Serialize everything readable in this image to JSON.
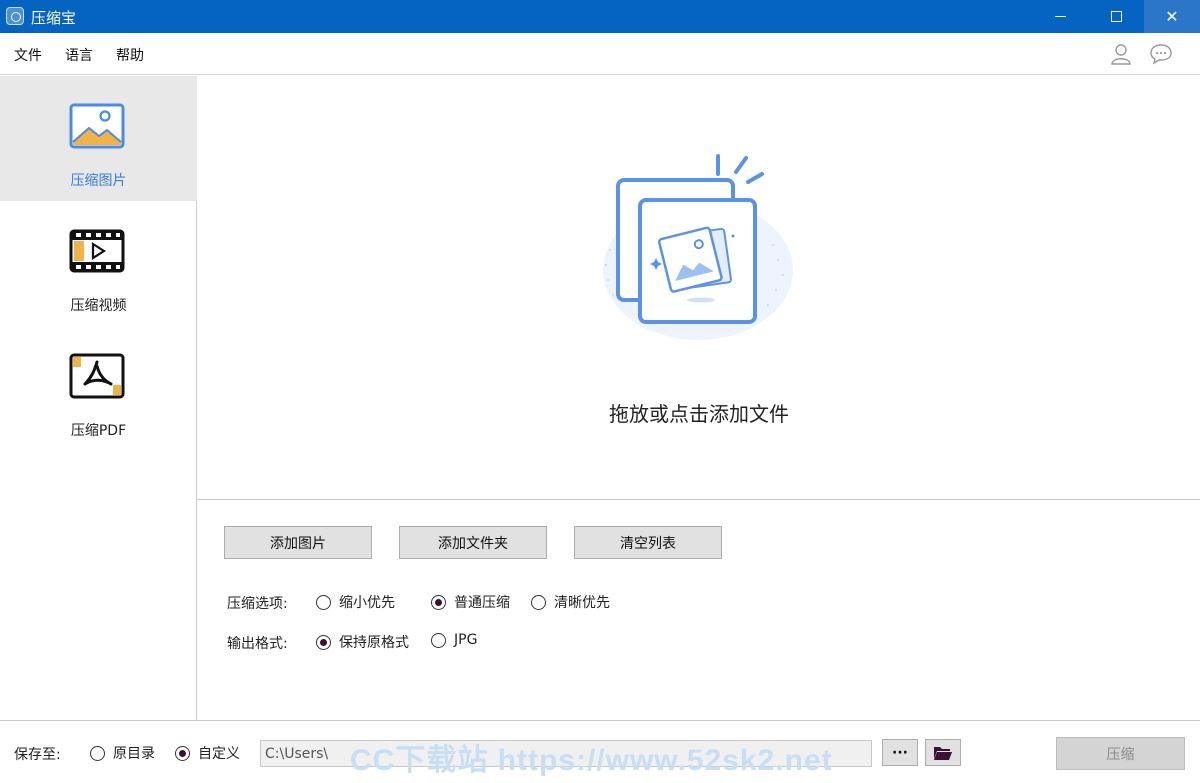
{
  "titlebar": {
    "title": "压缩宝",
    "close_glyph": "✕"
  },
  "menu": {
    "items": [
      {
        "label": "文件"
      },
      {
        "label": "语言"
      },
      {
        "label": "帮助"
      }
    ],
    "icons": [
      "user-icon",
      "chat-icon"
    ]
  },
  "sidebar": {
    "items": [
      {
        "label": "压缩图片",
        "icon": "image-icon",
        "active": true
      },
      {
        "label": "压缩视频",
        "icon": "film-icon",
        "active": false
      },
      {
        "label": "压缩PDF",
        "icon": "pdf-icon",
        "active": false
      }
    ]
  },
  "dropzone": {
    "text": "拖放或点击添加文件"
  },
  "actions": {
    "add_images": "添加图片",
    "add_folder": "添加文件夹",
    "clear_list": "清空列表"
  },
  "options": {
    "compress_label": "压缩选项:",
    "compress_choices": [
      {
        "label": "缩小优先",
        "selected": false
      },
      {
        "label": "普通压缩",
        "selected": true
      },
      {
        "label": "清晰优先",
        "selected": false
      }
    ],
    "format_label": "输出格式:",
    "format_choices": [
      {
        "label": "保持原格式",
        "selected": true
      },
      {
        "label": "JPG",
        "selected": false
      }
    ]
  },
  "bottom": {
    "save_to_label": "保存至:",
    "save_choices": [
      {
        "label": "原目录",
        "selected": false
      },
      {
        "label": "自定义",
        "selected": true
      }
    ],
    "path_value": "C:\\Users\\",
    "watermark": "CC下载站 https://www.52sk2.net",
    "more_label": "···",
    "folder_icon": "folder-open-icon",
    "compress_label": "压缩"
  },
  "colors": {
    "titlebar": "#0563c1",
    "accent": "#3a7de0",
    "sidebar_active_bg": "#e8e8e8"
  }
}
